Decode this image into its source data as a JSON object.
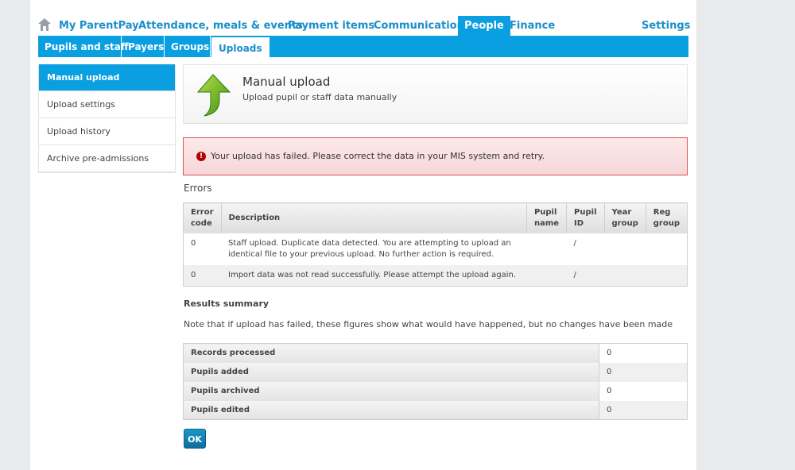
{
  "top_nav": {
    "home_label": "My ParentPay",
    "items": [
      "Attendance, meals & events",
      "Payment items",
      "Communication",
      "People",
      "Finance"
    ],
    "settings_label": "Settings"
  },
  "sub_nav": {
    "tabs": [
      "Pupils and staff",
      "Payers",
      "Groups",
      "Uploads"
    ]
  },
  "side_menu": {
    "items": [
      "Manual upload",
      "Upload settings",
      "Upload history",
      "Archive pre-admissions"
    ]
  },
  "header": {
    "title": "Manual upload",
    "subtitle": "Upload pupil or staff data manually"
  },
  "alert": {
    "icon_text": "!",
    "message": "Your upload has failed. Please correct the data in your MIS system and retry."
  },
  "errors": {
    "heading": "Errors",
    "columns": {
      "error_code_1": "Error",
      "error_code_2": "code",
      "description": "Description",
      "pupil_name_1": "Pupil",
      "pupil_name_2": "name",
      "pupil_id_1": "Pupil",
      "pupil_id_2": "ID",
      "year_group_1": "Year",
      "year_group_2": "group",
      "reg_group_1": "Reg",
      "reg_group_2": "group"
    },
    "rows": [
      {
        "code": "0",
        "description": "Staff upload. Duplicate data detected. You are attempting to upload an identical file to your previous upload. No further action is required.",
        "pupil_name": "",
        "pupil_id": "/",
        "year_group": "",
        "reg_group": ""
      },
      {
        "code": "0",
        "description": "Import data was not read successfully. Please attempt the upload again.",
        "pupil_name": "",
        "pupil_id": "/",
        "year_group": "",
        "reg_group": ""
      }
    ]
  },
  "results": {
    "heading": "Results summary",
    "note": "Note that if upload has failed, these figures show what would have happened, but no changes have been made",
    "rows": [
      {
        "label": "Records processed",
        "value": "0"
      },
      {
        "label": "Pupils added",
        "value": "0"
      },
      {
        "label": "Pupils archived",
        "value": "0"
      },
      {
        "label": "Pupils edited",
        "value": "0"
      }
    ]
  },
  "ok_label": "OK",
  "colors": {
    "accent": "#0a9fe0",
    "link": "#1b8fc9",
    "error_border": "#d9534f",
    "error_bg": "#fde9ea"
  }
}
